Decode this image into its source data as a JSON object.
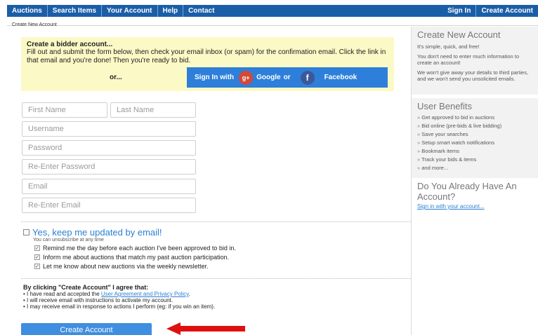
{
  "nav": {
    "left": [
      "Auctions",
      "Search Items",
      "Your Account",
      "Help",
      "Contact"
    ],
    "right": [
      "Sign In",
      "Create Account"
    ]
  },
  "breadcrumb": "Create New Account",
  "promo": {
    "title": "Create a bidder account...",
    "text": "Fill out and submit the form below, then check your email inbox (or spam) for the confirmation email. Click the link in that email and you're done! Then you're ready to bid.",
    "or": "or...",
    "social": {
      "sign_in_with": "Sign In with",
      "google": "Google",
      "or": "or",
      "facebook": "Facebook",
      "gplus_glyph": "g+",
      "fb_glyph": "f"
    }
  },
  "form": {
    "first_name": "First Name",
    "last_name": "Last Name",
    "username": "Username",
    "password": "Password",
    "re_password": "Re-Enter Password",
    "email": "Email",
    "re_email": "Re-Enter Email"
  },
  "updates": {
    "title": "Yes, keep me updated by email!",
    "unsubscribe": "You can unsubscribe at any time",
    "options": [
      "Remind me the day before each auction I've been approved to bid in.",
      "Inform me about auctions that match my past auction participation.",
      "Let me know about new auctions via the weekly newsletter."
    ]
  },
  "agreement": {
    "title": "By clicking \"Create Account\" I agree that:",
    "item1_pre": "I have read and accepted the ",
    "item1_link": "User Agreement and Privacy Policy",
    "item1_post": ".",
    "item2": "I will receive email with instructions to activate my account.",
    "item3": "I may receive email in response to actions I perform (eg: if you win an item)."
  },
  "create_button": "Create Account",
  "sidebar": {
    "create": {
      "title": "Create New Account",
      "p1": "It's simple, quick, and free!",
      "p2": "You don't need to enter much information to create an account!",
      "p3": "We won't give away your details to third parties, and we won't send you unsolicited emails."
    },
    "benefits": {
      "title": "User Benefits",
      "items": [
        "Get approved to bid in auctions",
        "Bid online (pre-bids & live bidding)",
        "Save your searches",
        "Setup smart watch notifications",
        "Bookmark items",
        "Track your bids & items",
        "and more..."
      ]
    },
    "have_account": {
      "title": "Do You Already Have An Account?",
      "link": "Sign in with your account..."
    }
  },
  "colors": {
    "nav": "#1a5ea8",
    "promo_bg": "#fbf9c5",
    "social_btn": "#2d7fda",
    "create_btn": "#3f8ee0",
    "arrow": "#e01010"
  }
}
